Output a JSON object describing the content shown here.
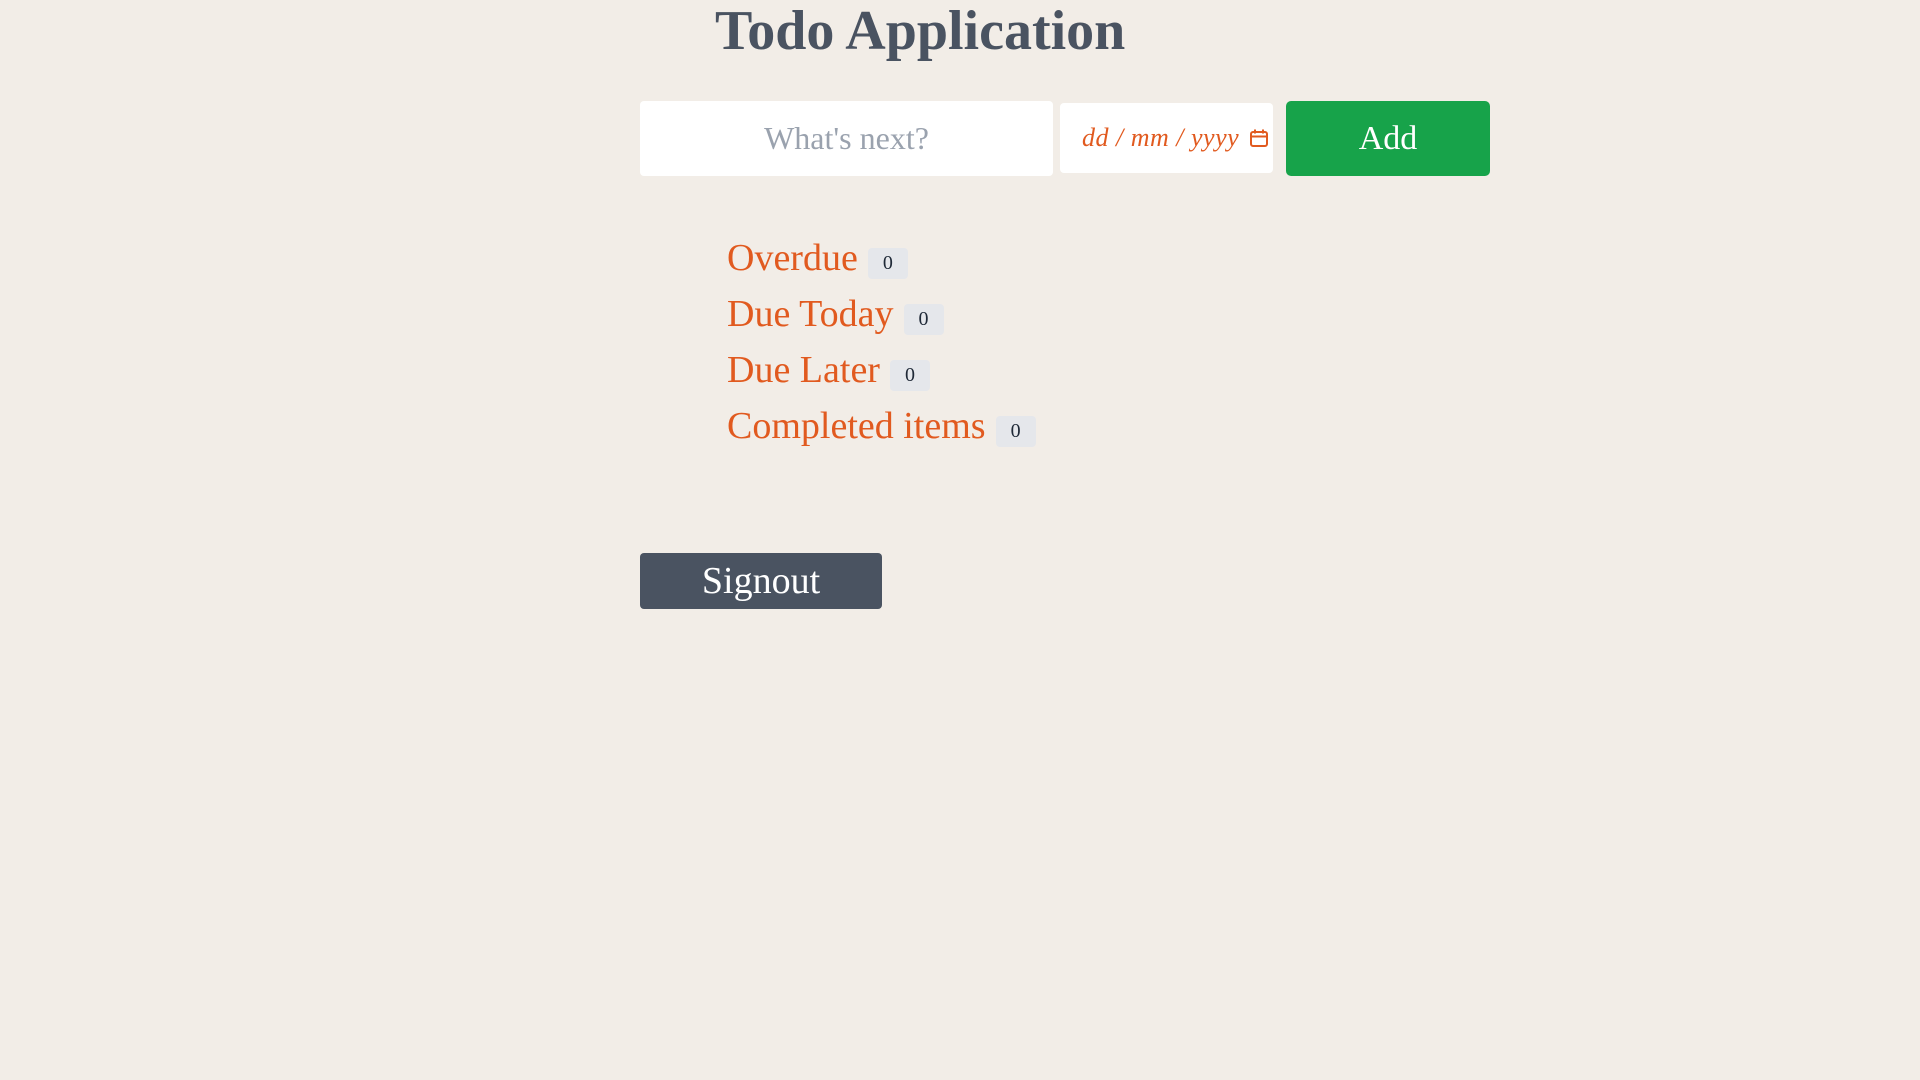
{
  "app": {
    "title": "Todo Application"
  },
  "form": {
    "todo_placeholder": "What's next?",
    "todo_value": "",
    "date_placeholder": "dd / mm / yyyy",
    "date_icon": "calendar-icon",
    "add_label": "Add"
  },
  "sections": [
    {
      "label": "Overdue",
      "count": "0"
    },
    {
      "label": "Due Today",
      "count": "0"
    },
    {
      "label": "Due Later",
      "count": "0"
    },
    {
      "label": "Completed items",
      "count": "0"
    }
  ],
  "footer": {
    "signout_label": "Signout"
  },
  "colors": {
    "background": "#f2ede7",
    "title": "#4a5361",
    "accent": "#e15a1f",
    "add_button": "#17a34a",
    "signout_button": "#4a5361",
    "badge": "#e5e7eb"
  }
}
